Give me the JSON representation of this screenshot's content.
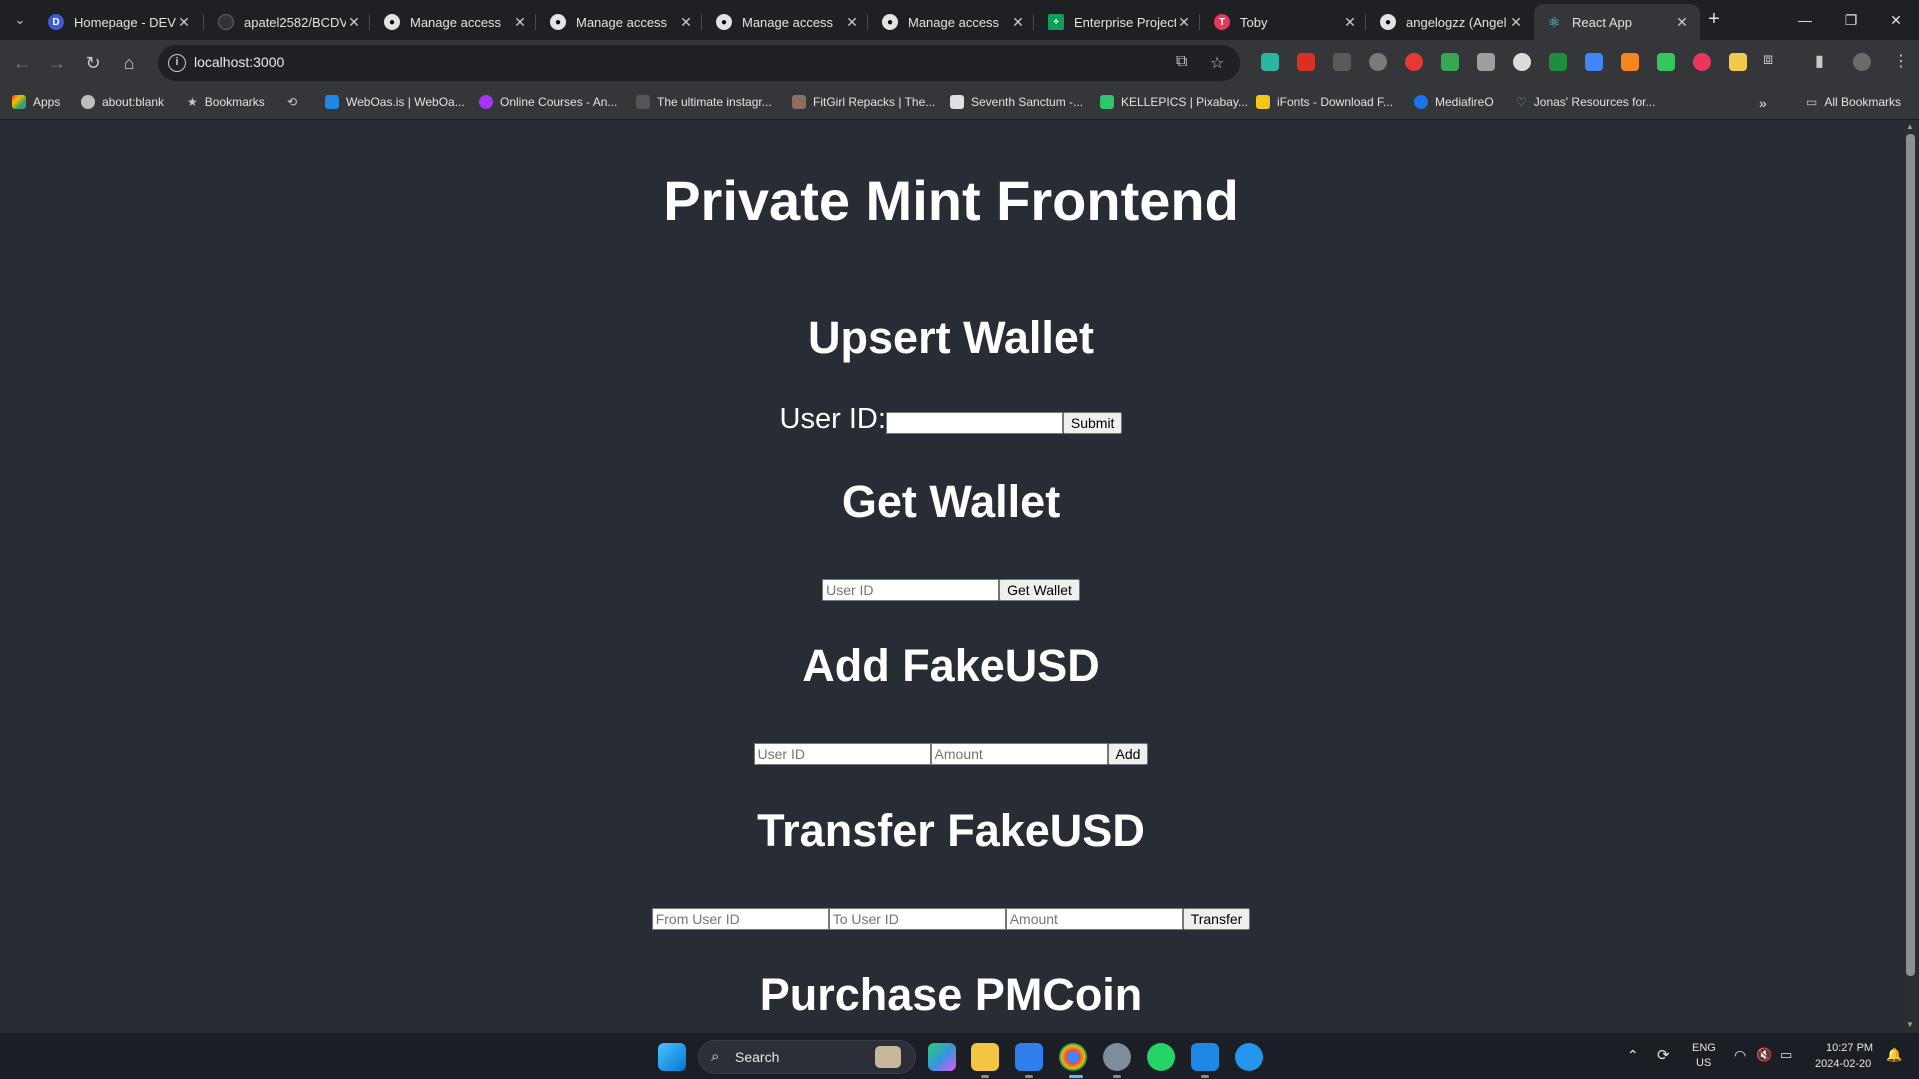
{
  "browser": {
    "tabs": [
      {
        "title": "Homepage - DEV",
        "favicon": "dev-icon",
        "color": "#3b5bdb",
        "active": false
      },
      {
        "title": "apatel2582/BCDV",
        "favicon": "github-icon",
        "color": "#000000",
        "active": false
      },
      {
        "title": "Manage access",
        "favicon": "github-icon",
        "color": "#000000",
        "active": false
      },
      {
        "title": "Manage access",
        "favicon": "github-icon",
        "color": "#000000",
        "active": false
      },
      {
        "title": "Manage access",
        "favicon": "github-icon",
        "color": "#000000",
        "active": false
      },
      {
        "title": "Manage access",
        "favicon": "github-icon",
        "color": "#000000",
        "active": false
      },
      {
        "title": "Enterprise Project",
        "favicon": "sheets-icon",
        "color": "#0f9d58",
        "active": false
      },
      {
        "title": "Toby",
        "favicon": "toby-icon",
        "color": "#e8365d",
        "active": false
      },
      {
        "title": "angelogzz (Angel",
        "favicon": "github-icon",
        "color": "#000000",
        "active": false
      },
      {
        "title": "React App",
        "favicon": "react-icon",
        "color": "#61dafb",
        "active": true
      }
    ],
    "address": "localhost:3000",
    "bookmarks": [
      {
        "label": "Apps",
        "icon": "apps-grid-icon"
      },
      {
        "label": "about:blank",
        "icon": "globe-icon"
      },
      {
        "label": "Bookmarks",
        "icon": "star-icon"
      },
      {
        "label": "",
        "icon": "history-icon"
      },
      {
        "label": "WebOas.is | WebOa...",
        "icon": "weboasis-icon"
      },
      {
        "label": "Online Courses - An...",
        "icon": "udemy-icon"
      },
      {
        "label": "The ultimate instagr...",
        "icon": "instagram-tool-icon"
      },
      {
        "label": "FitGirl Repacks | The...",
        "icon": "fitgirl-icon"
      },
      {
        "label": "Seventh Sanctum -...",
        "icon": "sanctum-icon"
      },
      {
        "label": "KELLEPICS | Pixabay...",
        "icon": "pixabay-icon"
      },
      {
        "label": "iFonts - Download F...",
        "icon": "ifonts-icon"
      },
      {
        "label": "MediafireO",
        "icon": "mediafire-icon"
      },
      {
        "label": "Jonas' Resources for...",
        "icon": "heart-icon"
      }
    ],
    "all_bookmarks": "All Bookmarks"
  },
  "page": {
    "title": "Private Mint Frontend",
    "upsert": {
      "heading": "Upsert Wallet",
      "label": "User ID:",
      "value": "",
      "button": "Submit"
    },
    "get_wallet": {
      "heading": "Get Wallet",
      "placeholder": "User ID",
      "button": "Get Wallet"
    },
    "add_fake": {
      "heading": "Add FakeUSD",
      "user_placeholder": "User ID",
      "amount_placeholder": "Amount",
      "button": "Add"
    },
    "transfer": {
      "heading": "Transfer FakeUSD",
      "from_placeholder": "From User ID",
      "to_placeholder": "To User ID",
      "amount_placeholder": "Amount",
      "button": "Transfer"
    },
    "purchase": {
      "heading": "Purchase PMCoin"
    }
  },
  "taskbar": {
    "search": "Search",
    "lang_top": "ENG",
    "lang_bottom": "US",
    "time": "10:27 PM",
    "date": "2024-02-20"
  }
}
